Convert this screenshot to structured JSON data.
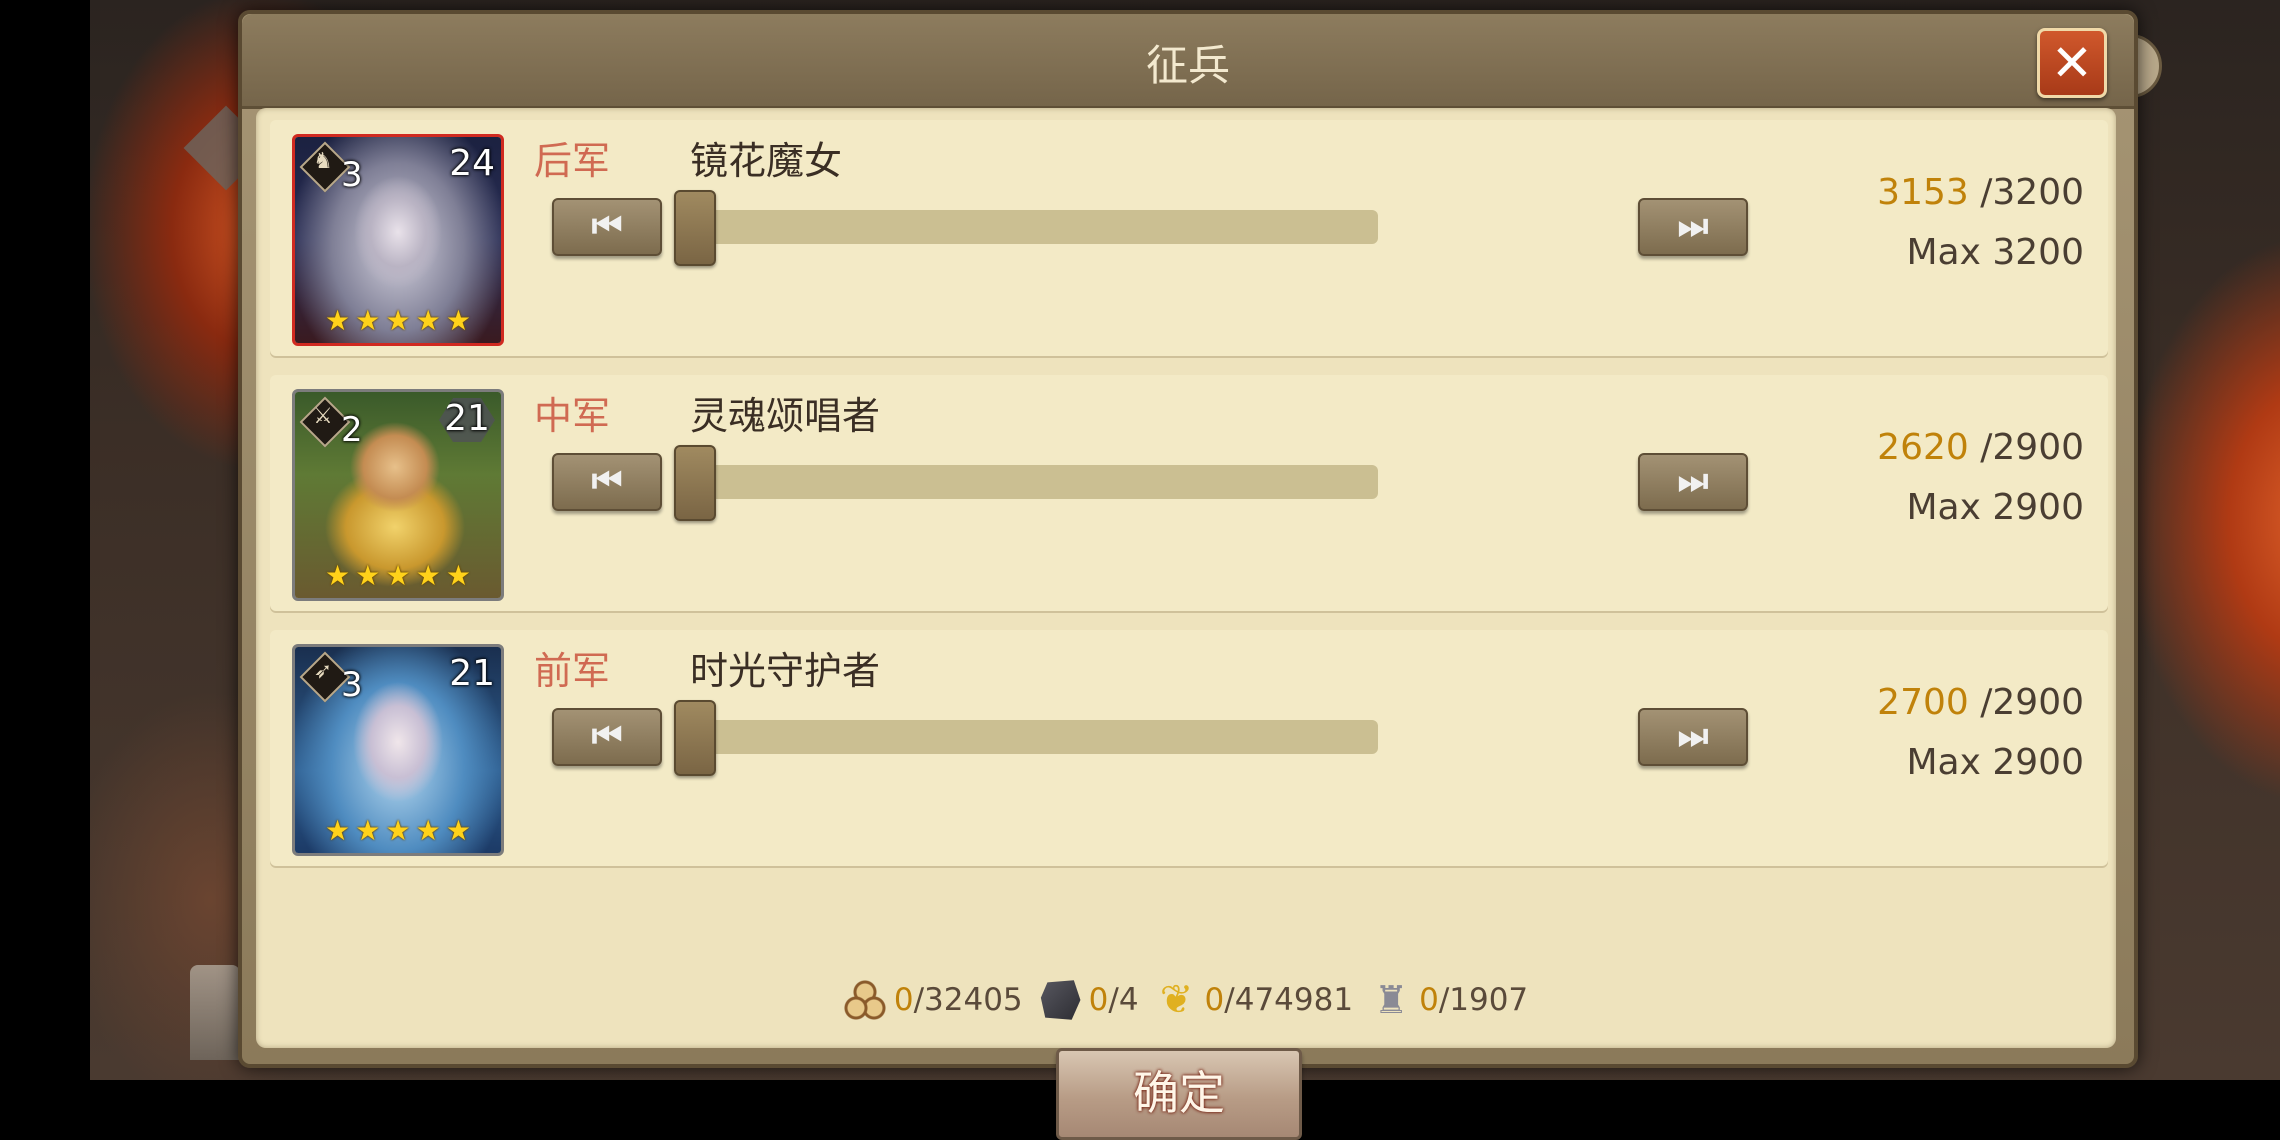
{
  "dialog": {
    "title": "征兵",
    "close_glyph": "✕",
    "confirm_label": "确定"
  },
  "rows": [
    {
      "position": "后军",
      "name": "镜花魔女",
      "type_icon": "horse-icon",
      "type_glyph": "♞",
      "rank": "3",
      "level": "24",
      "stars": 5,
      "current": "3153",
      "capacity": "/3200",
      "max": "Max 3200",
      "slider_value": 0
    },
    {
      "position": "中军",
      "name": "灵魂颂唱者",
      "type_icon": "sword-icon",
      "type_glyph": "⚔",
      "rank": "2",
      "level": "21",
      "stars": 5,
      "current": "2620",
      "capacity": "/2900",
      "max": "Max 2900",
      "slider_value": 0
    },
    {
      "position": "前军",
      "name": "时光守护者",
      "type_icon": "bow-icon",
      "type_glyph": "➶",
      "rank": "3",
      "level": "21",
      "stars": 5,
      "current": "2700",
      "capacity": "/2900",
      "max": "Max 2900",
      "slider_value": 0
    }
  ],
  "resources": [
    {
      "icon": "wood-icon",
      "current": "0",
      "total": "/32405"
    },
    {
      "icon": "ore-icon",
      "current": "0",
      "total": "/4"
    },
    {
      "icon": "grain-icon",
      "current": "0",
      "total": "/474981"
    },
    {
      "icon": "soldier-icon",
      "current": "0",
      "total": "/1907"
    }
  ],
  "icons": {
    "prev": "⏮",
    "next": "⏭",
    "star": "★",
    "grain": "❦",
    "soldier": "♜"
  },
  "colors": {
    "position_label": "#d06a52",
    "current_count": "#c0820a",
    "panel": "#eee3bd",
    "close_button": "#c04a20"
  }
}
